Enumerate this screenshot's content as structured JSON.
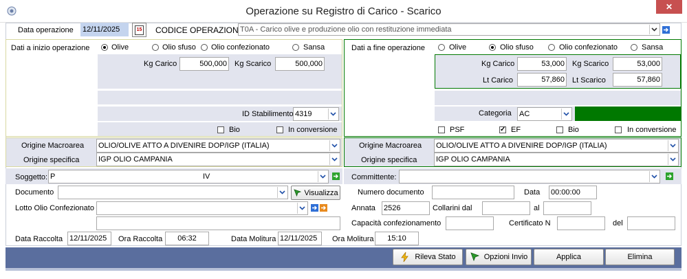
{
  "window": {
    "title": "Operazione su Registro di Carico - Scarico",
    "close_label": "✕"
  },
  "top": {
    "data_label": "Data operazione",
    "data_value": "12/11/2025",
    "codice_label": "CODICE OPERAZIONE:",
    "codice_value": "T0A - Carico olive e produzione olio con restituzione immediata",
    "calendar_text": "15"
  },
  "left": {
    "header": "Dati a inizio operazione",
    "radios": [
      "Olive",
      "Olio sfuso",
      "Olio confezionato",
      "Sansa"
    ],
    "kg_carico_label": "Kg Carico",
    "kg_carico": "500,000",
    "kg_scarico_label": "Kg Scarico",
    "kg_scarico": "500,000",
    "id_stab_label": "ID Stabilimento",
    "id_stab": "4319",
    "bio_label": "Bio",
    "conversione_label": "In conversione",
    "macro_label": "Origine Macroarea",
    "macro_value": "OLIO/OLIVE ATTO A DIVENIRE DOP/IGP (ITALIA)",
    "spec_label": "Origine specifica",
    "spec_value": "IGP OLIO CAMPANIA"
  },
  "right": {
    "header": "Dati a fine operazione",
    "radios": [
      "Olive",
      "Olio sfuso",
      "Olio confezionato",
      "Sansa"
    ],
    "kg_carico_label": "Kg Carico",
    "kg_carico": "53,000",
    "kg_scarico_label": "Kg Scarico",
    "kg_scarico": "53,000",
    "lt_carico_label": "Lt Carico",
    "lt_carico": "57,860",
    "lt_scarico_label": "Lt Scarico",
    "lt_scarico": "57,860",
    "categoria_label": "Categoria",
    "categoria": "AC",
    "psf_label": "PSF",
    "ef_label": "EF",
    "bio_label": "Bio",
    "conversione_label": "In conversione",
    "macro_label": "Origine Macroarea",
    "macro_value": "OLIO/OLIVE ATTO A DIVENIRE DOP/IGP (ITALIA)",
    "spec_label": "Origine specifica",
    "spec_value": "IGP OLIO CAMPANIA"
  },
  "soggetto": {
    "label": "Soggetto:",
    "value_left": "P",
    "value_right": "IV"
  },
  "committente": {
    "label": "Committente:",
    "value": ""
  },
  "documento": {
    "label": "Documento",
    "value": "",
    "visualizza": "Visualizza"
  },
  "numdoc": {
    "label": "Numero documento",
    "value": "",
    "data_label": "Data",
    "data_value": "00:00:00"
  },
  "lotto": {
    "label": "Lotto Olio Confezionato",
    "value": "",
    "extra": ""
  },
  "annata": {
    "label": "Annata",
    "value": "2526",
    "collarini_label": "Collarini dal",
    "collarini_dal": "",
    "al_label": "al",
    "al_value": ""
  },
  "capacita": {
    "label": "Capacità confezionamento",
    "value": "",
    "cert_label": "Certificato N",
    "cert_value": "",
    "del_label": "del",
    "del_value": ""
  },
  "dates": {
    "data_raccolta_label": "Data Raccolta",
    "data_raccolta": "12/11/2025",
    "ora_raccolta_label": "Ora Raccolta",
    "ora_raccolta": "06:32",
    "data_molitura_label": "Data Molitura",
    "data_molitura": "12/11/2025",
    "ora_molitura_label": "Ora Molitura",
    "ora_molitura": "15:10"
  },
  "buttons": {
    "rileva": "Rileva Stato",
    "opzioni": "Opzioni Invio",
    "applica": "Applica",
    "elimina": "Elimina"
  },
  "colors": {
    "green": "#007800",
    "panel": "#e2e4ee",
    "footer": "#5a6e9e",
    "accent": "#c75050"
  }
}
